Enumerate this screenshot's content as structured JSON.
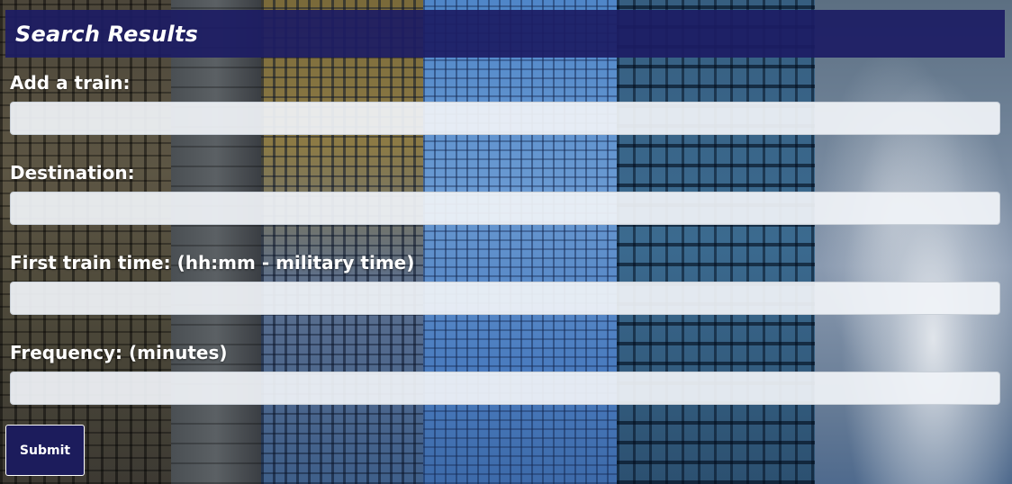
{
  "header": {
    "title": "Search Results"
  },
  "form": {
    "train_label": "Add a train:",
    "train_value": "",
    "destination_label": "Destination:",
    "destination_value": "",
    "first_time_label": "First train time: (hh:mm - military time)",
    "first_time_value": "",
    "frequency_label": "Frequency: (minutes)",
    "frequency_value": "",
    "submit_label": "Submit"
  },
  "colors": {
    "header_bg": "#1c1c64",
    "button_bg": "#1c1c5c",
    "field_bg": "#f0f3f7",
    "label_text": "#ffffff"
  }
}
